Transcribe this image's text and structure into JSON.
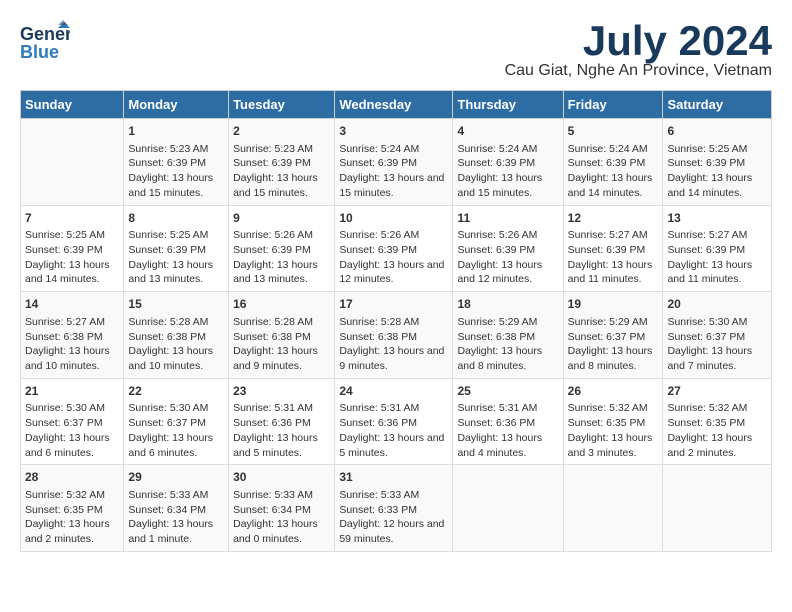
{
  "header": {
    "logo_line1": "General",
    "logo_line2": "Blue",
    "title": "July 2024",
    "subtitle": "Cau Giat, Nghe An Province, Vietnam"
  },
  "days_of_week": [
    "Sunday",
    "Monday",
    "Tuesday",
    "Wednesday",
    "Thursday",
    "Friday",
    "Saturday"
  ],
  "weeks": [
    [
      {
        "day": "",
        "sunrise": "",
        "sunset": "",
        "daylight": ""
      },
      {
        "day": "1",
        "sunrise": "Sunrise: 5:23 AM",
        "sunset": "Sunset: 6:39 PM",
        "daylight": "Daylight: 13 hours and 15 minutes."
      },
      {
        "day": "2",
        "sunrise": "Sunrise: 5:23 AM",
        "sunset": "Sunset: 6:39 PM",
        "daylight": "Daylight: 13 hours and 15 minutes."
      },
      {
        "day": "3",
        "sunrise": "Sunrise: 5:24 AM",
        "sunset": "Sunset: 6:39 PM",
        "daylight": "Daylight: 13 hours and 15 minutes."
      },
      {
        "day": "4",
        "sunrise": "Sunrise: 5:24 AM",
        "sunset": "Sunset: 6:39 PM",
        "daylight": "Daylight: 13 hours and 15 minutes."
      },
      {
        "day": "5",
        "sunrise": "Sunrise: 5:24 AM",
        "sunset": "Sunset: 6:39 PM",
        "daylight": "Daylight: 13 hours and 14 minutes."
      },
      {
        "day": "6",
        "sunrise": "Sunrise: 5:25 AM",
        "sunset": "Sunset: 6:39 PM",
        "daylight": "Daylight: 13 hours and 14 minutes."
      }
    ],
    [
      {
        "day": "7",
        "sunrise": "Sunrise: 5:25 AM",
        "sunset": "Sunset: 6:39 PM",
        "daylight": "Daylight: 13 hours and 14 minutes."
      },
      {
        "day": "8",
        "sunrise": "Sunrise: 5:25 AM",
        "sunset": "Sunset: 6:39 PM",
        "daylight": "Daylight: 13 hours and 13 minutes."
      },
      {
        "day": "9",
        "sunrise": "Sunrise: 5:26 AM",
        "sunset": "Sunset: 6:39 PM",
        "daylight": "Daylight: 13 hours and 13 minutes."
      },
      {
        "day": "10",
        "sunrise": "Sunrise: 5:26 AM",
        "sunset": "Sunset: 6:39 PM",
        "daylight": "Daylight: 13 hours and 12 minutes."
      },
      {
        "day": "11",
        "sunrise": "Sunrise: 5:26 AM",
        "sunset": "Sunset: 6:39 PM",
        "daylight": "Daylight: 13 hours and 12 minutes."
      },
      {
        "day": "12",
        "sunrise": "Sunrise: 5:27 AM",
        "sunset": "Sunset: 6:39 PM",
        "daylight": "Daylight: 13 hours and 11 minutes."
      },
      {
        "day": "13",
        "sunrise": "Sunrise: 5:27 AM",
        "sunset": "Sunset: 6:39 PM",
        "daylight": "Daylight: 13 hours and 11 minutes."
      }
    ],
    [
      {
        "day": "14",
        "sunrise": "Sunrise: 5:27 AM",
        "sunset": "Sunset: 6:38 PM",
        "daylight": "Daylight: 13 hours and 10 minutes."
      },
      {
        "day": "15",
        "sunrise": "Sunrise: 5:28 AM",
        "sunset": "Sunset: 6:38 PM",
        "daylight": "Daylight: 13 hours and 10 minutes."
      },
      {
        "day": "16",
        "sunrise": "Sunrise: 5:28 AM",
        "sunset": "Sunset: 6:38 PM",
        "daylight": "Daylight: 13 hours and 9 minutes."
      },
      {
        "day": "17",
        "sunrise": "Sunrise: 5:28 AM",
        "sunset": "Sunset: 6:38 PM",
        "daylight": "Daylight: 13 hours and 9 minutes."
      },
      {
        "day": "18",
        "sunrise": "Sunrise: 5:29 AM",
        "sunset": "Sunset: 6:38 PM",
        "daylight": "Daylight: 13 hours and 8 minutes."
      },
      {
        "day": "19",
        "sunrise": "Sunrise: 5:29 AM",
        "sunset": "Sunset: 6:37 PM",
        "daylight": "Daylight: 13 hours and 8 minutes."
      },
      {
        "day": "20",
        "sunrise": "Sunrise: 5:30 AM",
        "sunset": "Sunset: 6:37 PM",
        "daylight": "Daylight: 13 hours and 7 minutes."
      }
    ],
    [
      {
        "day": "21",
        "sunrise": "Sunrise: 5:30 AM",
        "sunset": "Sunset: 6:37 PM",
        "daylight": "Daylight: 13 hours and 6 minutes."
      },
      {
        "day": "22",
        "sunrise": "Sunrise: 5:30 AM",
        "sunset": "Sunset: 6:37 PM",
        "daylight": "Daylight: 13 hours and 6 minutes."
      },
      {
        "day": "23",
        "sunrise": "Sunrise: 5:31 AM",
        "sunset": "Sunset: 6:36 PM",
        "daylight": "Daylight: 13 hours and 5 minutes."
      },
      {
        "day": "24",
        "sunrise": "Sunrise: 5:31 AM",
        "sunset": "Sunset: 6:36 PM",
        "daylight": "Daylight: 13 hours and 5 minutes."
      },
      {
        "day": "25",
        "sunrise": "Sunrise: 5:31 AM",
        "sunset": "Sunset: 6:36 PM",
        "daylight": "Daylight: 13 hours and 4 minutes."
      },
      {
        "day": "26",
        "sunrise": "Sunrise: 5:32 AM",
        "sunset": "Sunset: 6:35 PM",
        "daylight": "Daylight: 13 hours and 3 minutes."
      },
      {
        "day": "27",
        "sunrise": "Sunrise: 5:32 AM",
        "sunset": "Sunset: 6:35 PM",
        "daylight": "Daylight: 13 hours and 2 minutes."
      }
    ],
    [
      {
        "day": "28",
        "sunrise": "Sunrise: 5:32 AM",
        "sunset": "Sunset: 6:35 PM",
        "daylight": "Daylight: 13 hours and 2 minutes."
      },
      {
        "day": "29",
        "sunrise": "Sunrise: 5:33 AM",
        "sunset": "Sunset: 6:34 PM",
        "daylight": "Daylight: 13 hours and 1 minute."
      },
      {
        "day": "30",
        "sunrise": "Sunrise: 5:33 AM",
        "sunset": "Sunset: 6:34 PM",
        "daylight": "Daylight: 13 hours and 0 minutes."
      },
      {
        "day": "31",
        "sunrise": "Sunrise: 5:33 AM",
        "sunset": "Sunset: 6:33 PM",
        "daylight": "Daylight: 12 hours and 59 minutes."
      },
      {
        "day": "",
        "sunrise": "",
        "sunset": "",
        "daylight": ""
      },
      {
        "day": "",
        "sunrise": "",
        "sunset": "",
        "daylight": ""
      },
      {
        "day": "",
        "sunrise": "",
        "sunset": "",
        "daylight": ""
      }
    ]
  ]
}
